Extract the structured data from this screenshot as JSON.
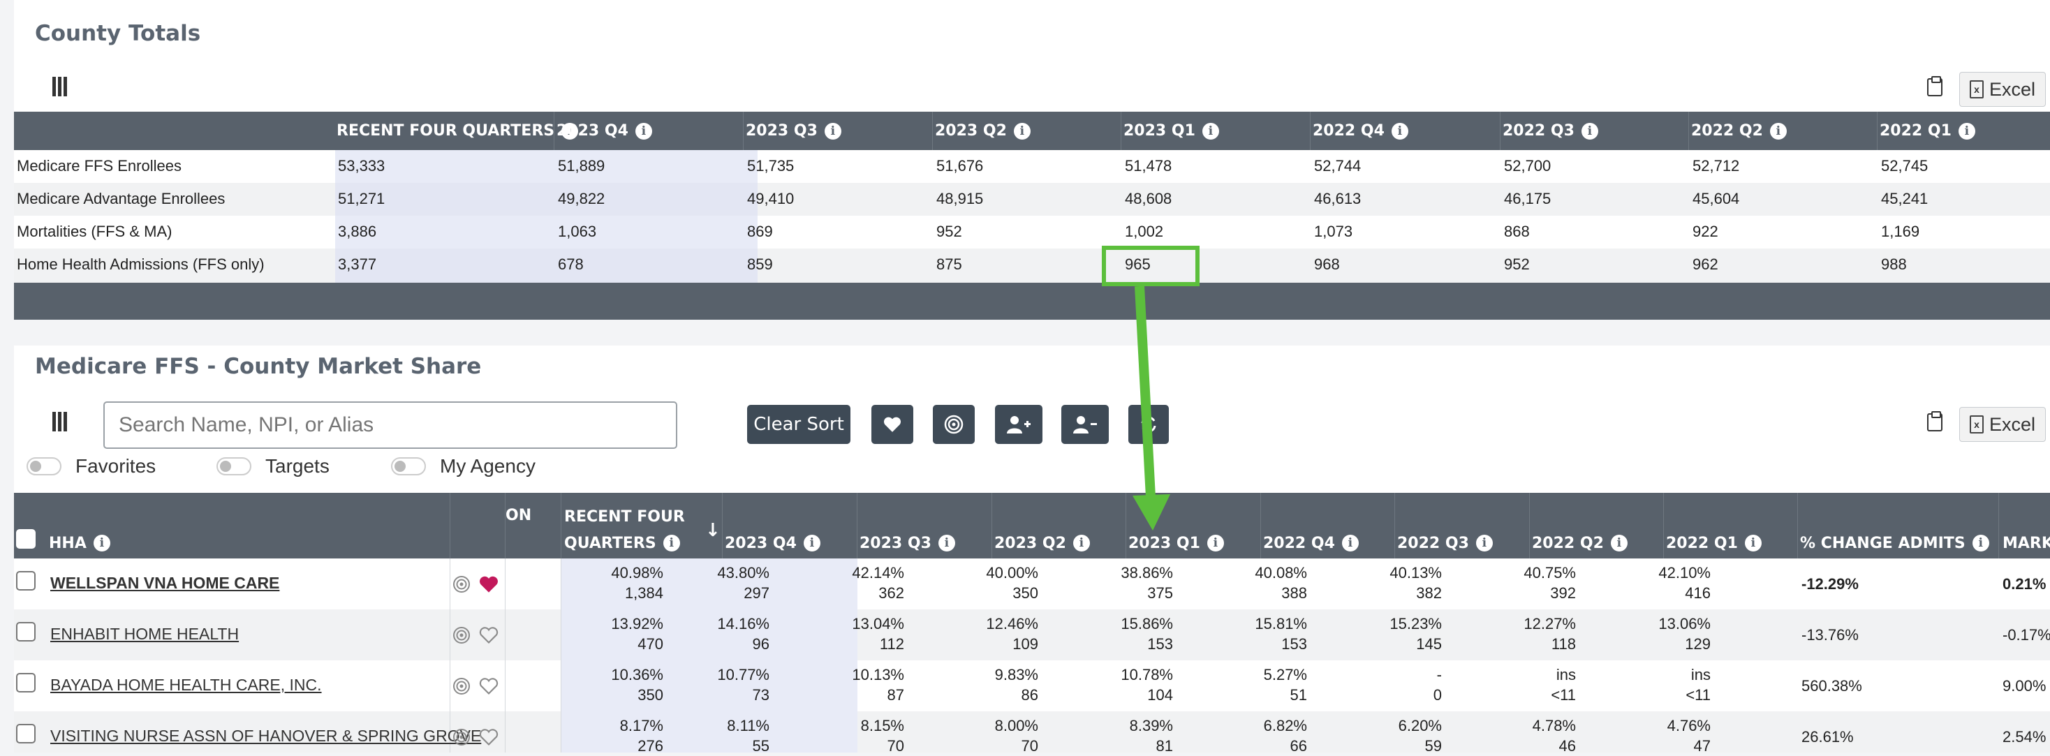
{
  "county_totals": {
    "title": "County Totals",
    "excel_label": "Excel",
    "columns": [
      "RECENT FOUR QUARTERS",
      "2023 Q4",
      "2023 Q3",
      "2023 Q2",
      "2023 Q1",
      "2022 Q4",
      "2022 Q3",
      "2022 Q2",
      "2022 Q1"
    ],
    "rows": [
      {
        "label": "Medicare FFS Enrollees",
        "values": [
          "53,333",
          "51,889",
          "51,735",
          "51,676",
          "51,478",
          "52,744",
          "52,700",
          "52,712",
          "52,745"
        ]
      },
      {
        "label": "Medicare Advantage Enrollees",
        "values": [
          "51,271",
          "49,822",
          "49,410",
          "48,915",
          "48,608",
          "46,613",
          "46,175",
          "45,604",
          "45,241"
        ]
      },
      {
        "label": "Mortalities (FFS & MA)",
        "values": [
          "3,886",
          "1,063",
          "869",
          "952",
          "1,002",
          "1,073",
          "868",
          "922",
          "1,169"
        ]
      },
      {
        "label": "Home Health Admissions (FFS only)",
        "values": [
          "3,377",
          "678",
          "859",
          "875",
          "965",
          "968",
          "952",
          "962",
          "988"
        ]
      }
    ]
  },
  "market_share": {
    "title": "Medicare FFS - County Market Share",
    "excel_label": "Excel",
    "search_placeholder": "Search Name, NPI, or Alias",
    "clear_sort_label": "Clear Sort",
    "toggles": [
      "Favorites",
      "Targets",
      "My Agency"
    ],
    "col_hha": "HHA",
    "col_on": "ON",
    "col_recent_line1": "RECENT FOUR",
    "col_recent_line2": "QUARTERS",
    "sort_arrow": "↓",
    "quarter_columns": [
      "2023 Q4",
      "2023 Q3",
      "2023 Q2",
      "2023 Q1",
      "2022 Q4",
      "2022 Q3",
      "2022 Q2",
      "2022 Q1"
    ],
    "col_change": "% CHANGE ADMITS",
    "col_market": "MARKE",
    "rows": [
      {
        "name": "WELLSPAN VNA HOME CARE",
        "favorite": true,
        "pct": [
          "40.98%",
          "43.80%",
          "42.14%",
          "40.00%",
          "38.86%",
          "40.08%",
          "40.13%",
          "40.75%",
          "42.10%"
        ],
        "cnt": [
          "1,384",
          "297",
          "362",
          "350",
          "375",
          "388",
          "382",
          "392",
          "416"
        ],
        "change": "-12.29%",
        "market": "0.21%"
      },
      {
        "name": "ENHABIT HOME HEALTH",
        "favorite": false,
        "pct": [
          "13.92%",
          "14.16%",
          "13.04%",
          "12.46%",
          "15.86%",
          "15.81%",
          "15.23%",
          "12.27%",
          "13.06%"
        ],
        "cnt": [
          "470",
          "96",
          "112",
          "109",
          "153",
          "153",
          "145",
          "118",
          "129"
        ],
        "change": "-13.76%",
        "market": "-0.17%"
      },
      {
        "name": "BAYADA HOME HEALTH CARE, INC.",
        "favorite": false,
        "pct": [
          "10.36%",
          "10.77%",
          "10.13%",
          "9.83%",
          "10.78%",
          "5.27%",
          "-",
          "ins",
          "ins"
        ],
        "cnt": [
          "350",
          "73",
          "87",
          "86",
          "104",
          "51",
          "0",
          "<11",
          "<11"
        ],
        "change": "560.38%",
        "market": "9.00%"
      },
      {
        "name": "VISITING NURSE ASSN OF HANOVER & SPRING GROVE",
        "favorite": false,
        "pct": [
          "8.17%",
          "8.11%",
          "8.15%",
          "8.00%",
          "8.39%",
          "6.82%",
          "6.20%",
          "4.78%",
          "4.76%"
        ],
        "cnt": [
          "276",
          "55",
          "70",
          "70",
          "81",
          "66",
          "59",
          "46",
          "47"
        ],
        "change": "26.61%",
        "market": "2.54%"
      }
    ]
  },
  "annotation_color": "#5cbf3c",
  "header_color": "#58616b"
}
